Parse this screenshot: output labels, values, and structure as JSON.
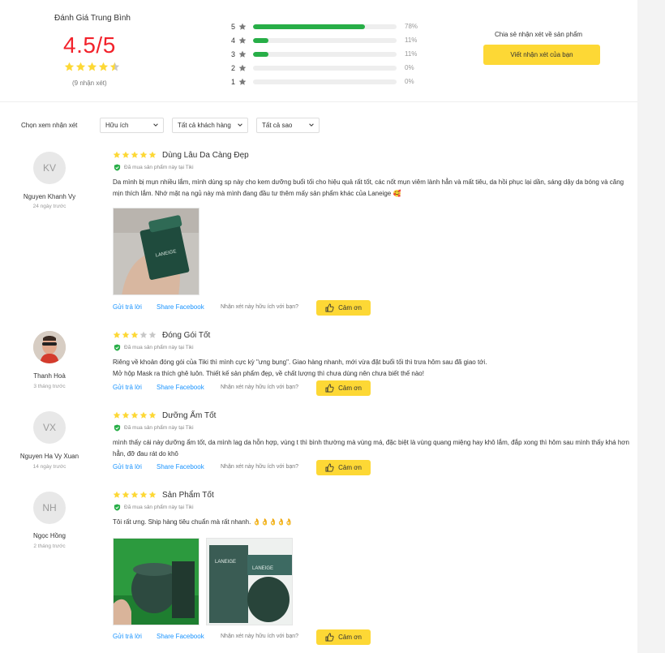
{
  "summary": {
    "title": "Đánh Giá Trung Bình",
    "score": "4.5/5",
    "count_text": "(9 nhận xét)",
    "stars_value": 4.5,
    "distribution": [
      {
        "star": "5",
        "percent": 78,
        "label": "78%"
      },
      {
        "star": "4",
        "percent": 11,
        "label": "11%"
      },
      {
        "star": "3",
        "percent": 11,
        "label": "11%"
      },
      {
        "star": "2",
        "percent": 0,
        "label": "0%"
      },
      {
        "star": "1",
        "percent": 0,
        "label": "0%"
      }
    ],
    "share_prompt": "Chia sẻ nhận xét về sản phẩm",
    "write_button": "Viết nhận xét của bạn"
  },
  "filters": {
    "label": "Chọn xem nhận xét",
    "options": [
      "Hữu ích",
      "Tất cả khách hàng",
      "Tất cả sao"
    ]
  },
  "actions": {
    "reply": "Gửi trả lời",
    "share": "Share Facebook",
    "helpful_question": "Nhận xét này hữu ích với bạn?",
    "thanks": "Cảm ơn"
  },
  "verified_text": "Đã mua sản phẩm này tại Tiki",
  "reviews": [
    {
      "initials": "KV",
      "name": "Nguyen Khanh Vy",
      "time": "24 ngày trước",
      "stars": 5,
      "title": "Dùng Lâu Da Càng Đẹp",
      "text": "Da mình bị mụn nhiều lắm, mình dùng sp này cho kem dưỡng buổi tối cho hiệu quả rất tốt, các nốt mụn viêm lành hẳn và mất tiêu, da hồi phục lại dần, sáng dậy da bóng và căng mịn thích lắm. Nhớ mặt nạ ngủ này mà mình đang đầu tư thêm mấy sản phẩm khác của Laneige 🥰"
    },
    {
      "initials": "",
      "name": "Thanh Hoà",
      "time": "3 tháng trước",
      "stars": 3,
      "title": "Đóng Gói Tốt",
      "text": "Riêng về khoản đóng gói của Tiki thì mình cực kỳ \"ưng bụng\". Giao hàng nhanh, mới vừa đặt buổi tối thì trưa hôm sau đã giao tới.\nMở hộp Mask ra thích ghê luôn. Thiết kế sản phẩm đẹp, về chất lượng thì chưa dùng nên chưa biết thế nào!"
    },
    {
      "initials": "VX",
      "name": "Nguyen Ha Vy Xuan",
      "time": "14 ngày trước",
      "stars": 5,
      "title": "Dưỡng Ẩm Tốt",
      "text": "mình thấy cái này dưỡng ẩm tốt, da mình lag da hỗn hợp, vùng t thì bình thường mà vùng má, đặc biệt là vùng quang miệng hay khô lắm, đắp xong thì hôm sau mình thấy khá hơn hẳn, đỡ đau rát do khô"
    },
    {
      "initials": "NH",
      "name": "Ngọc Hồng",
      "time": "2 tháng trước",
      "stars": 5,
      "title": "Sản Phẩm Tốt",
      "text": "Tôi rất ưng. Ship hàng tiêu chuẩn mà rất nhanh. 👌👌👌👌👌"
    }
  ],
  "product_brand": "LANEIGE",
  "colors": {
    "accent_yellow": "#fdd835",
    "score_red": "#f2222b",
    "star_gold": "#fdd835",
    "bar_green": "#27ae47",
    "link_blue": "#1a94ff",
    "verified_green": "#27ae47"
  }
}
